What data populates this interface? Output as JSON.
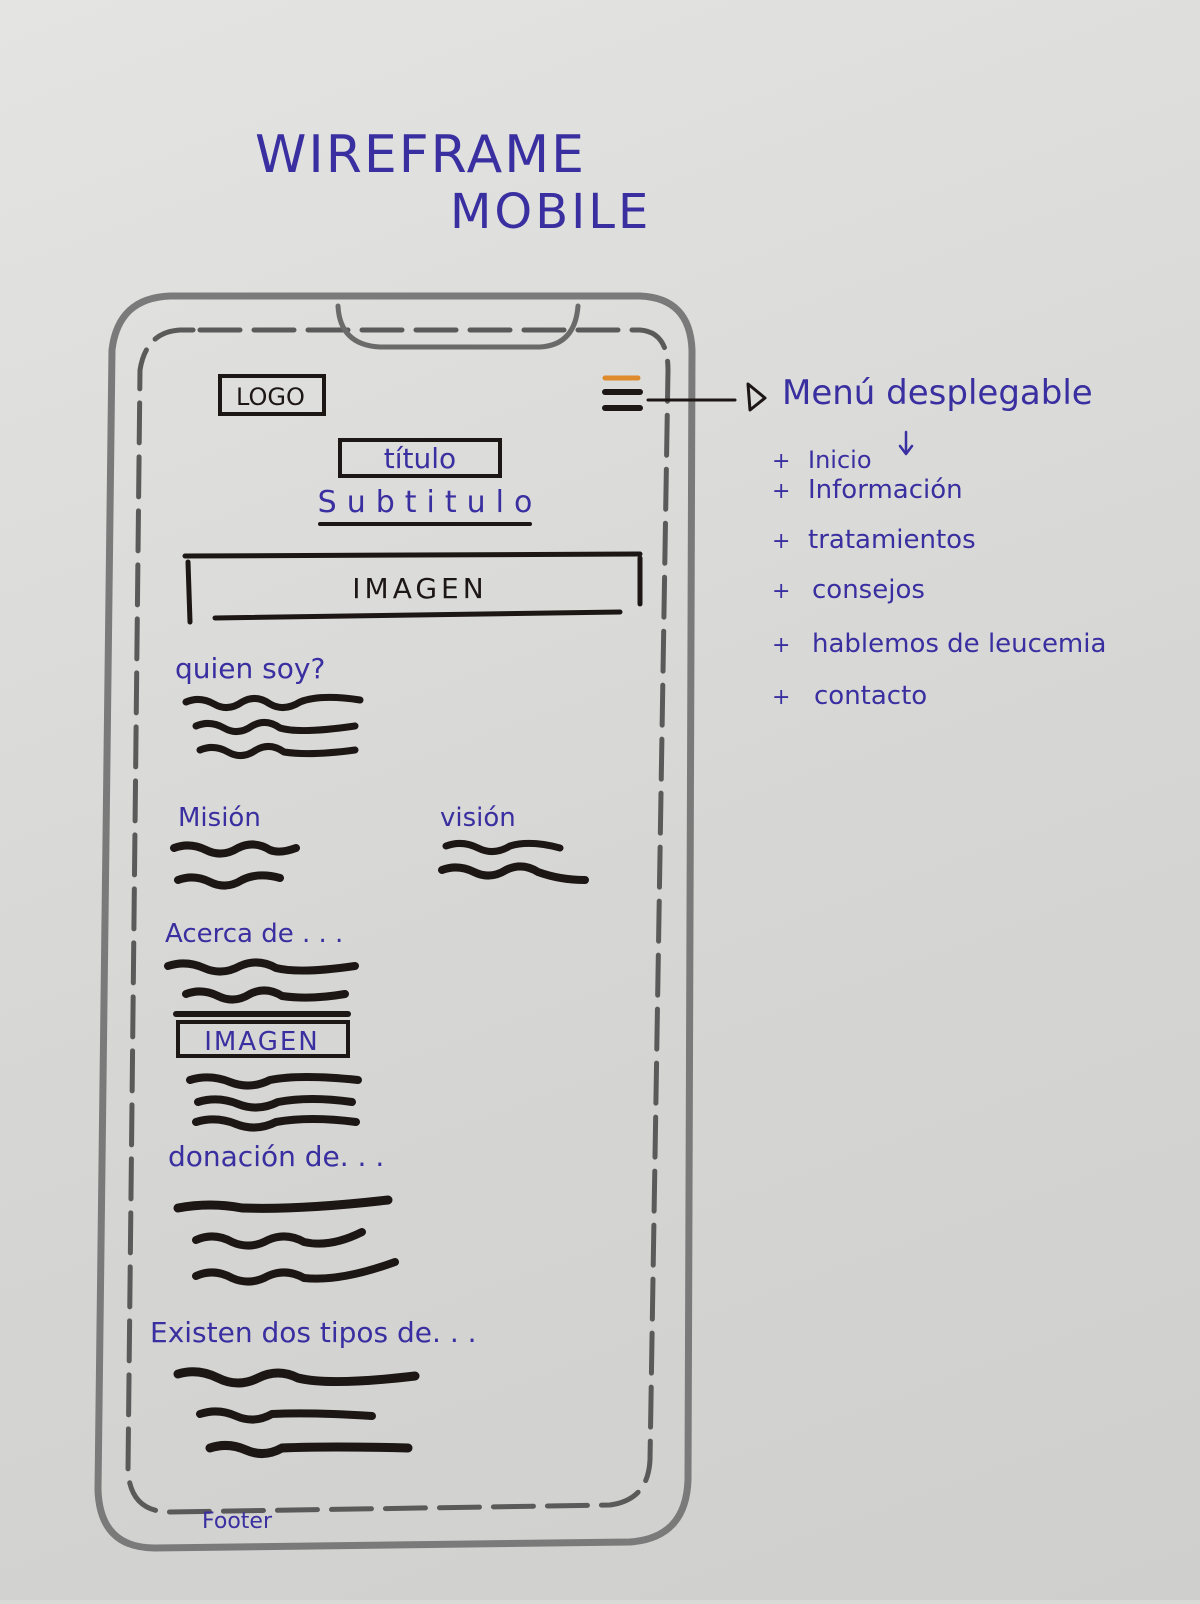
{
  "heading": {
    "line1": "WIREFRAME",
    "line2": "MOBILE"
  },
  "phone": {
    "logo": "LOGO",
    "title": "título",
    "subtitle": "Subtitulo",
    "hero_image": "IMAGEN",
    "sections": {
      "about": "quien soy?",
      "mission": "Misión",
      "vision": "visión",
      "acerca": "Acerca de . . .",
      "inline_image": "IMAGEN",
      "donation": "donación de. . .",
      "types": "Existen dos tipos de. . ."
    },
    "footer": "Footer"
  },
  "menu_note": {
    "label": "Menú desplegable",
    "items": [
      "Inicio",
      "Información",
      "tratamientos",
      "consejos",
      "hablemos de leucemia",
      "contacto"
    ]
  },
  "colors": {
    "pen_blue": "#3a2fa0",
    "marker_black": "#1c1614",
    "pencil_gray": "#6e6e6e",
    "accent_orange": "#e08a2e"
  }
}
